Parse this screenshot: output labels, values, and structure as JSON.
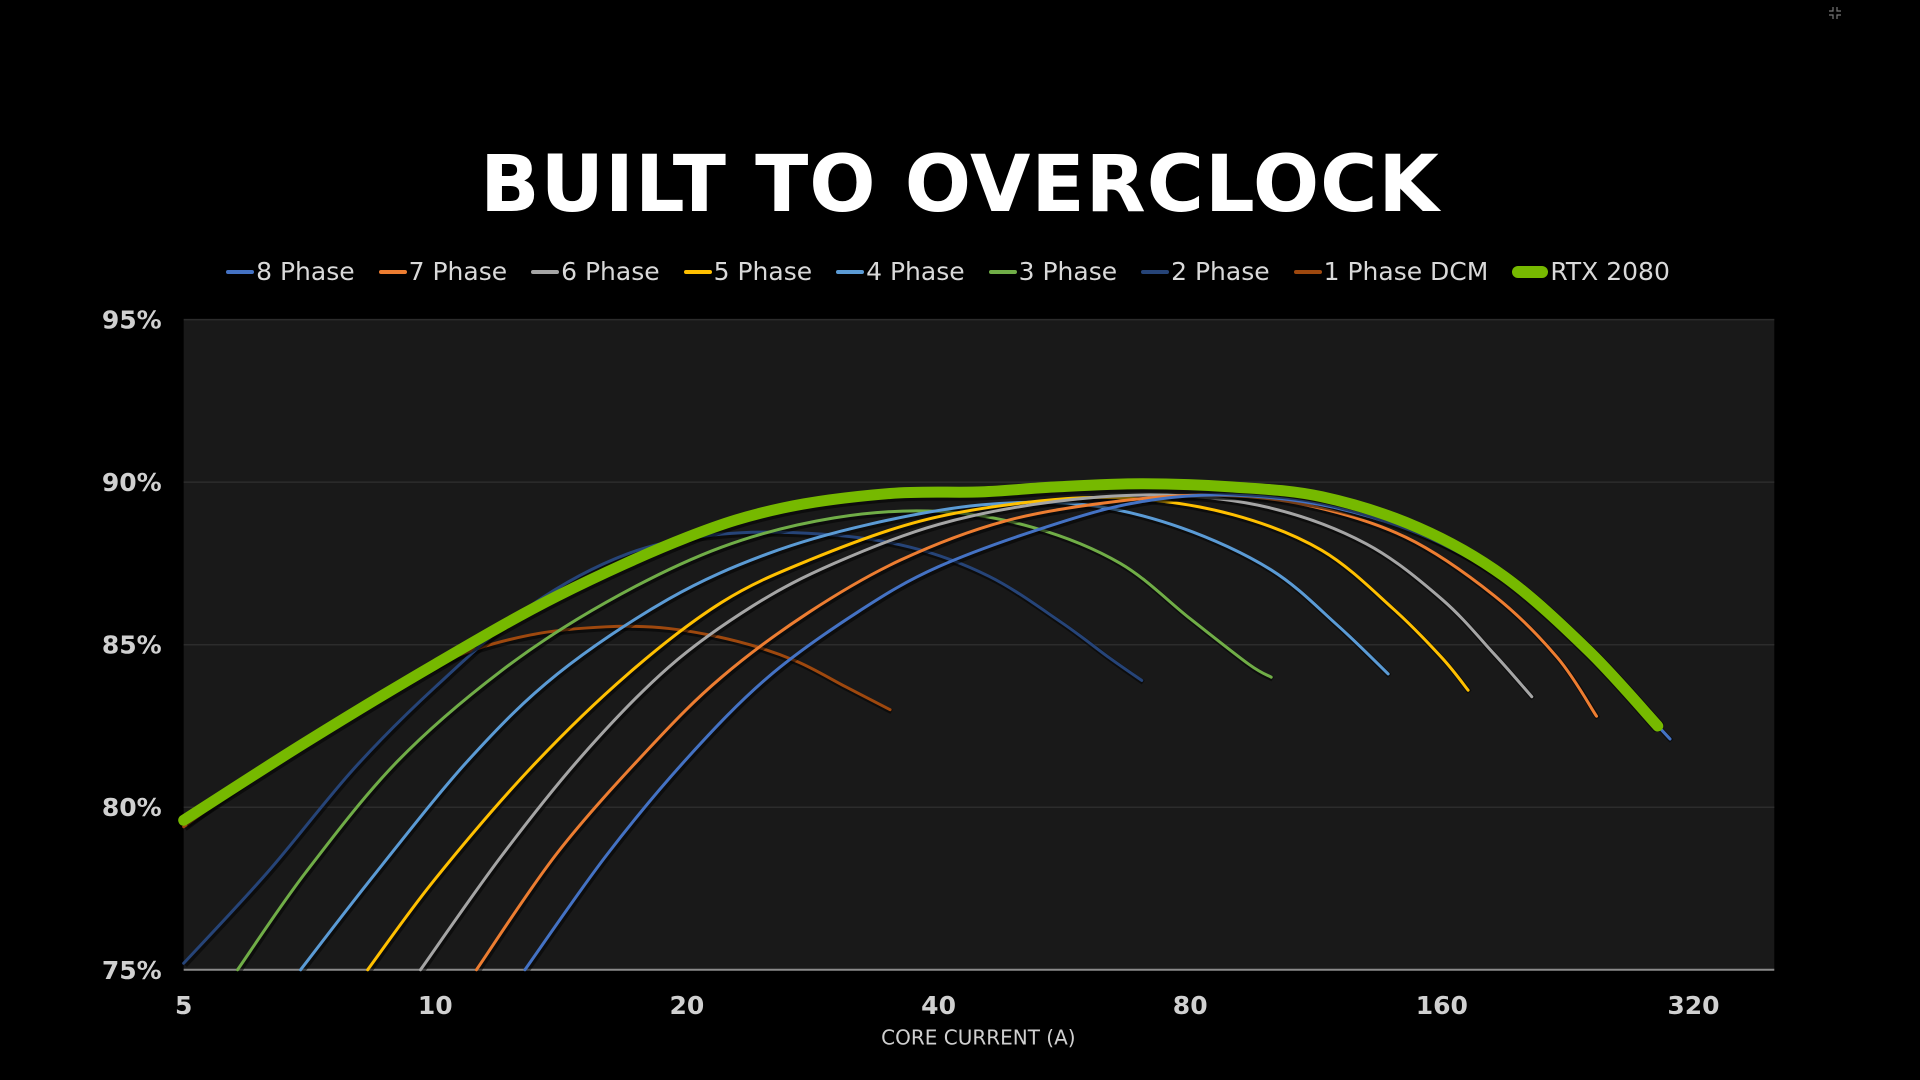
{
  "slide": {
    "title": "BUILT TO OVERCLOCK",
    "exit_fullscreen_icon": "exit-fullscreen-icon"
  },
  "chart_data": {
    "type": "line",
    "title": "BUILT TO OVERCLOCK",
    "xlabel": "CORE CURRENT (A)",
    "ylabel": "",
    "x_scale": "log2",
    "xlim": [
      5,
      450
    ],
    "ylim": [
      75,
      95
    ],
    "x_ticks": [
      5,
      10,
      20,
      40,
      80,
      160,
      320
    ],
    "x_tick_labels": [
      "5",
      "10",
      "20",
      "40",
      "80",
      "160",
      "320"
    ],
    "y_ticks": [
      75,
      80,
      85,
      90,
      95
    ],
    "y_tick_labels": [
      "75%",
      "80%",
      "85%",
      "90%",
      "95%"
    ],
    "grid": true,
    "legend_position": "top",
    "background": "#191919",
    "series": [
      {
        "name": "8 Phase",
        "color": "#4472C4",
        "width": 3,
        "points": [
          [
            12.8,
            75
          ],
          [
            16,
            78.5
          ],
          [
            20,
            81.5
          ],
          [
            25,
            84
          ],
          [
            32,
            86
          ],
          [
            40,
            87.4
          ],
          [
            55,
            88.7
          ],
          [
            70,
            89.4
          ],
          [
            90,
            89.6
          ],
          [
            120,
            89.2
          ],
          [
            160,
            88.1
          ],
          [
            210,
            86.2
          ],
          [
            260,
            83.8
          ],
          [
            300,
            82.1
          ]
        ]
      },
      {
        "name": "7 Phase",
        "color": "#ED7D31",
        "width": 3,
        "points": [
          [
            11.2,
            75
          ],
          [
            14,
            78.6
          ],
          [
            18,
            81.8
          ],
          [
            22,
            84
          ],
          [
            28,
            86
          ],
          [
            36,
            87.6
          ],
          [
            48,
            88.8
          ],
          [
            65,
            89.4
          ],
          [
            85,
            89.6
          ],
          [
            110,
            89.3
          ],
          [
            145,
            88.3
          ],
          [
            185,
            86.5
          ],
          [
            220,
            84.6
          ],
          [
            245,
            82.8
          ]
        ]
      },
      {
        "name": "6 Phase",
        "color": "#A5A5A5",
        "width": 3,
        "points": [
          [
            9.6,
            75
          ],
          [
            12,
            78.5
          ],
          [
            15,
            81.6
          ],
          [
            19,
            84.3
          ],
          [
            24,
            86.2
          ],
          [
            30,
            87.5
          ],
          [
            40,
            88.7
          ],
          [
            55,
            89.4
          ],
          [
            75,
            89.6
          ],
          [
            100,
            89.2
          ],
          [
            130,
            88.1
          ],
          [
            160,
            86.4
          ],
          [
            185,
            84.7
          ],
          [
            205,
            83.4
          ]
        ]
      },
      {
        "name": "5 Phase",
        "color": "#FFC000",
        "width": 3,
        "points": [
          [
            8.3,
            75
          ],
          [
            10,
            77.8
          ],
          [
            13,
            81.2
          ],
          [
            17,
            84.1
          ],
          [
            22,
            86.3
          ],
          [
            28,
            87.6
          ],
          [
            38,
            88.8
          ],
          [
            52,
            89.4
          ],
          [
            68,
            89.5
          ],
          [
            90,
            89
          ],
          [
            115,
            87.9
          ],
          [
            140,
            86.1
          ],
          [
            160,
            84.6
          ],
          [
            172,
            83.6
          ]
        ]
      },
      {
        "name": "4 Phase",
        "color": "#5B9BD5",
        "width": 3,
        "points": [
          [
            6.9,
            75
          ],
          [
            8.5,
            78
          ],
          [
            11,
            81.5
          ],
          [
            14,
            84.1
          ],
          [
            19,
            86.4
          ],
          [
            25,
            87.8
          ],
          [
            33,
            88.7
          ],
          [
            45,
            89.3
          ],
          [
            60,
            89.3
          ],
          [
            78,
            88.6
          ],
          [
            100,
            87.3
          ],
          [
            120,
            85.6
          ],
          [
            138,
            84.1
          ]
        ]
      },
      {
        "name": "3 Phase",
        "color": "#70AD47",
        "width": 3,
        "points": [
          [
            5.8,
            75
          ],
          [
            7,
            78
          ],
          [
            9,
            81.4
          ],
          [
            12,
            84.2
          ],
          [
            16,
            86.3
          ],
          [
            22,
            88
          ],
          [
            30,
            88.9
          ],
          [
            40,
            89.1
          ],
          [
            52,
            88.6
          ],
          [
            66,
            87.5
          ],
          [
            80,
            85.8
          ],
          [
            94,
            84.4
          ],
          [
            100,
            84
          ]
        ]
      },
      {
        "name": "2 Phase",
        "color": "#264478",
        "width": 3,
        "points": [
          [
            5,
            75.2
          ],
          [
            6.3,
            78
          ],
          [
            8,
            81.2
          ],
          [
            10,
            83.7
          ],
          [
            13,
            86.2
          ],
          [
            17,
            87.8
          ],
          [
            22,
            88.4
          ],
          [
            29,
            88.4
          ],
          [
            37,
            88
          ],
          [
            46,
            87.1
          ],
          [
            56,
            85.7
          ],
          [
            64,
            84.6
          ],
          [
            70,
            83.9
          ]
        ]
      },
      {
        "name": "1 Phase DCM",
        "color": "#9E480E",
        "width": 3,
        "points": [
          [
            5,
            79.4
          ],
          [
            6.5,
            81.5
          ],
          [
            8.5,
            83.3
          ],
          [
            10.5,
            84.6
          ],
          [
            13,
            85.3
          ],
          [
            16,
            85.55
          ],
          [
            19,
            85.5
          ],
          [
            23,
            85.1
          ],
          [
            27,
            84.5
          ],
          [
            31,
            83.7
          ],
          [
            35,
            83
          ]
        ]
      },
      {
        "name": "RTX 2080",
        "color": "#76B900",
        "width": 11,
        "points": [
          [
            5,
            79.6
          ],
          [
            7,
            82
          ],
          [
            10,
            84.4
          ],
          [
            14,
            86.5
          ],
          [
            20,
            88.3
          ],
          [
            26,
            89.2
          ],
          [
            35,
            89.65
          ],
          [
            45,
            89.7
          ],
          [
            55,
            89.85
          ],
          [
            70,
            89.95
          ],
          [
            90,
            89.85
          ],
          [
            115,
            89.55
          ],
          [
            150,
            88.6
          ],
          [
            190,
            87.1
          ],
          [
            240,
            84.8
          ],
          [
            290,
            82.5
          ]
        ]
      }
    ]
  }
}
